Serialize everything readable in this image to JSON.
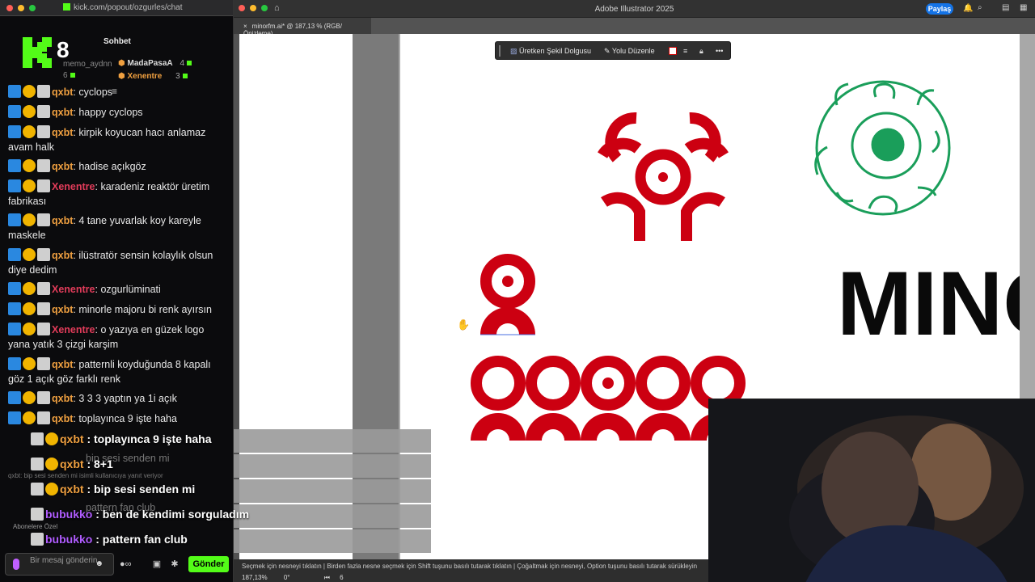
{
  "chat": {
    "window_url": "kick.com/popout/ozgurles/chat",
    "tab_label": "Sohbet",
    "badge_count": "8",
    "top_chatters": [
      {
        "name": "memo_aydnn",
        "count": "6"
      },
      {
        "name": "MadaPasaA",
        "count": "4"
      },
      {
        "name": "Xenentre",
        "count": "3"
      }
    ],
    "messages": [
      {
        "user": "qxbt",
        "text": ": cyclops"
      },
      {
        "user": "qxbt",
        "text": ": happy cyclops"
      },
      {
        "user": "qxbt",
        "text": ": kirpik koyucan hacı anlamaz avam halk"
      },
      {
        "user": "qxbt",
        "text": ": hadise açıkgöz"
      },
      {
        "user": "Xenentre",
        "text": ": karadeniz reaktör üretim fabrikası"
      },
      {
        "user": "qxbt",
        "text": ": 4 tane yuvarlak koy kareyle maskele"
      },
      {
        "user": "qxbt",
        "text": ": ilüstratör sensin kolaylık olsun diye dedim"
      },
      {
        "user": "Xenentre",
        "text": ": ozgurlüminati"
      },
      {
        "user": "qxbt",
        "text": ": minorle majoru bi renk ayırsın"
      },
      {
        "user": "Xenentre",
        "text": ": o yazıya en güzek logo yana yatık 3 çizgi karşim"
      },
      {
        "user": "qxbt",
        "text": ": patternli koyduğunda 8 kapalı göz 1 açık göz farklı renk"
      },
      {
        "user": "qxbt",
        "text": ": 3 3 3 yaptın ya 1i açık"
      },
      {
        "user": "qxbt",
        "text": ": toplayınca 9 işte haha"
      }
    ],
    "overlay_messages": [
      {
        "user": "qxbt",
        "text": " : toplayınca 9 işte haha"
      },
      {
        "user": "qxbt",
        "text": " : 8+1"
      },
      {
        "user": "qxbt",
        "text": " : bip sesi senden mi"
      },
      {
        "user": "bubukko",
        "text": " : ben de kendimi sorguladım"
      },
      {
        "user": "bubukko",
        "text": " : pattern fan club"
      }
    ],
    "partial_behind": [
      {
        "text": "bip sesi senden mi"
      },
      {
        "text": "pattern fan club"
      }
    ],
    "reply_hint": "qxbt: bip sesi senden mi isimli kullanıcıya yanıt veriyor",
    "subs_label": "Abonelere Özel",
    "input_placeholder": "Bir mesaj gönderin",
    "send_label": "Gönder"
  },
  "illustrator": {
    "app_title": "Adobe Illustrator 2025",
    "share_label": "Paylaş",
    "doc_tab": "minorfm.ai* @ 187,13 % (RGB/Önizleme)",
    "context_bar": {
      "generative_fill": "Üretken Şekil Dolgusu",
      "edit_path": "Yolu Düzenle"
    },
    "wordmark": "MINO",
    "status_text": "Seçmek için nesneyi tıklatın  |  Birden fazla nesne seçmek için Shift tuşunu basılı tutarak tıklatın  |  Çoğaltmak için nesneyi, Option tuşunu basılı tutarak sürükleyin",
    "zoom": "187,13%",
    "rotation": "0°",
    "artboard_index": "6",
    "colors": {
      "red": "#cc0011",
      "green": "#1a9e5a"
    }
  }
}
